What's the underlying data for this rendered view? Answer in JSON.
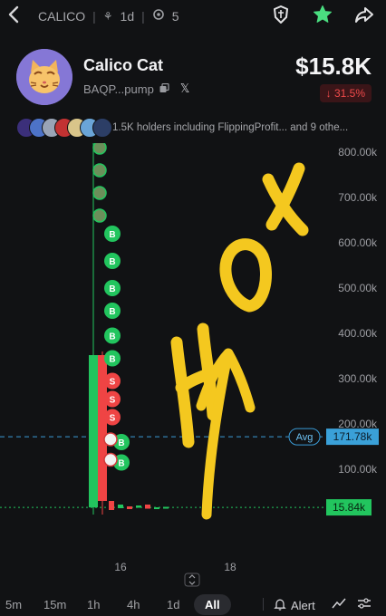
{
  "topbar": {
    "back_icon": "chevron-left-icon",
    "ticker": "CALICO",
    "age": "1d",
    "count": "5"
  },
  "token": {
    "name": "Calico Cat",
    "address": "BAQP...pump",
    "price": "$15.8K",
    "change": "↓ 31.5%",
    "change_color": "#f04a4a"
  },
  "holders": {
    "text": "1.5K holders including FlippingProfit... and 9 othe..."
  },
  "chart_data": {
    "type": "candlestick",
    "y_ticks": [
      "800.00k",
      "700.00k",
      "600.00k",
      "500.00k",
      "400.00k",
      "300.00k",
      "200.00k",
      "100.00k"
    ],
    "y_values": [
      800000,
      700000,
      600000,
      500000,
      400000,
      300000,
      200000,
      100000
    ],
    "ylim": [
      0,
      820000
    ],
    "x_ticks": [
      "16",
      "18"
    ],
    "avg_label": "Avg",
    "avg_value": "171.78k",
    "avg_number": 171780,
    "current_value": "15.84k",
    "current_number": 15840,
    "up_color": "#22c55e",
    "down_color": "#ef4444",
    "annotation": "HOX",
    "trade_markers": [
      {
        "label": "B",
        "value": 620000
      },
      {
        "label": "B",
        "value": 560000
      },
      {
        "label": "B",
        "value": 500000
      },
      {
        "label": "B",
        "value": 450000
      },
      {
        "label": "B",
        "value": 395000
      },
      {
        "label": "B",
        "value": 345000
      },
      {
        "label": "S",
        "value": 295000
      },
      {
        "label": "S",
        "value": 255000
      },
      {
        "label": "S",
        "value": 215000
      },
      {
        "label": "B",
        "value": 160000
      },
      {
        "label": "B",
        "value": 115000
      }
    ]
  },
  "timeframes": [
    "5m",
    "15m",
    "1h",
    "4h",
    "1d",
    "All"
  ],
  "active_timeframe": "All",
  "alert_label": "Alert"
}
